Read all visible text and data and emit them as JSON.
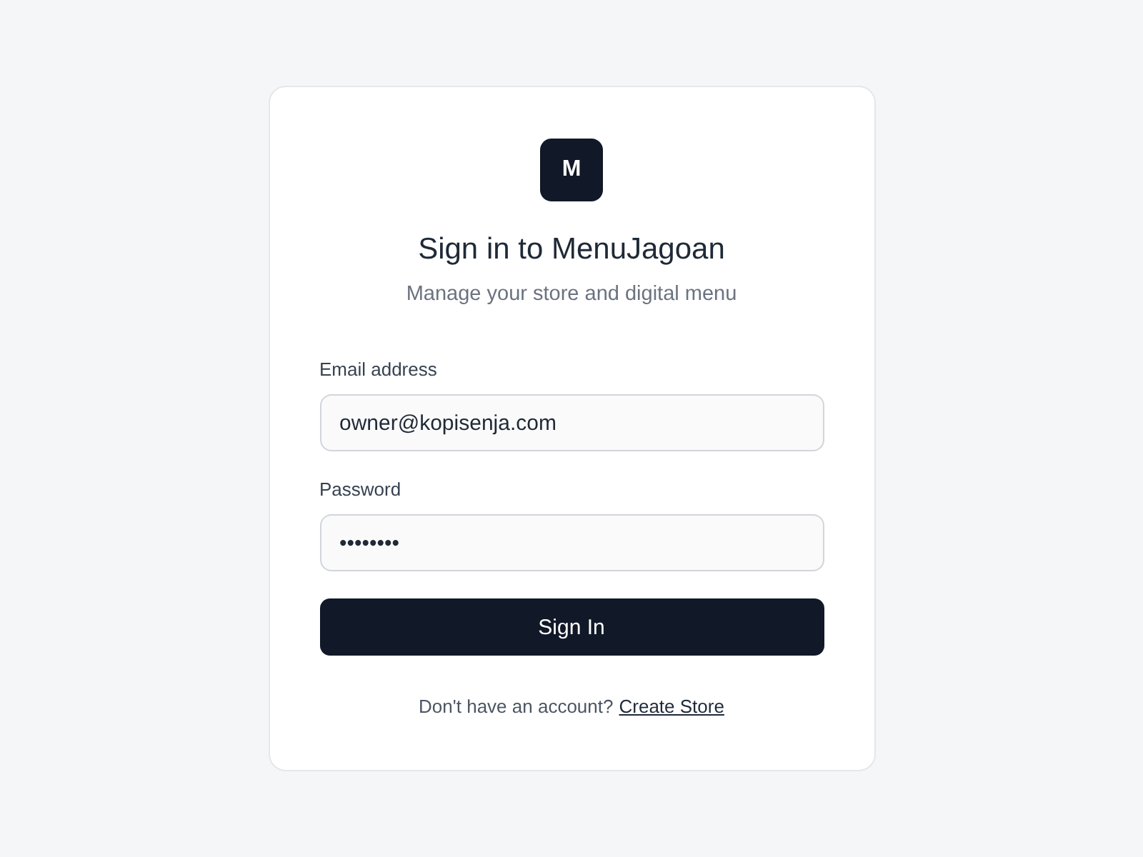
{
  "logo": {
    "letter": "M"
  },
  "title": "Sign in to MenuJagoan",
  "subtitle": "Manage your store and digital menu",
  "fields": [
    {
      "label": "Email address",
      "value": "owner@kopisenja.com"
    },
    {
      "label": "Password",
      "value": "••••••••"
    }
  ],
  "submit": {
    "label": "Sign In"
  },
  "footer": {
    "text": "Don't have an account?",
    "link": "Create Store"
  }
}
